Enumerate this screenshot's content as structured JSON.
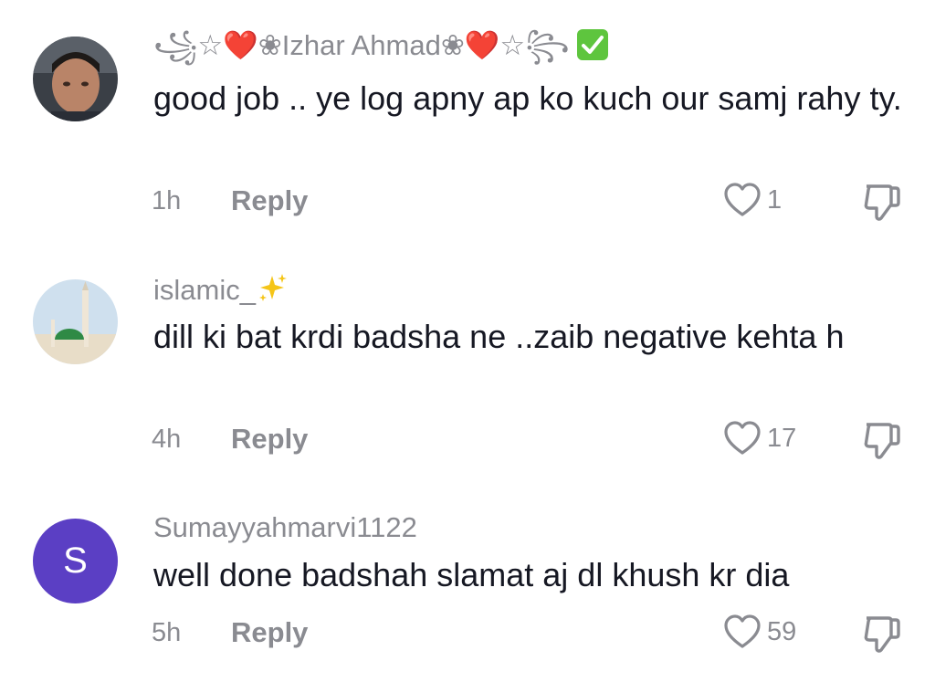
{
  "comments": [
    {
      "username": "꧁☆❤️❀Izhar Ahmad❀❤️☆꧂",
      "verified": true,
      "avatar": "profile-photo",
      "text": "good job .. ye log apny ap ko kuch our samj rahy ty.",
      "time": "1h",
      "reply_label": "Reply",
      "likes": "1"
    },
    {
      "username": "islamic_",
      "username_emoji": "sparkles",
      "avatar": "mosque-photo",
      "text": "dill ki bat krdi badsha ne ..zaib negative kehta h",
      "time": "4h",
      "reply_label": "Reply",
      "likes": "17"
    },
    {
      "username": "Sumayyahmarvi1122",
      "avatar": "letter-avatar",
      "avatar_letter": "S",
      "avatar_color": "#5b3fc4",
      "text": "well done badshah slamat aj dl khush kr dia",
      "time": "5h",
      "reply_label": "Reply",
      "likes": "59"
    }
  ],
  "colors": {
    "text": "#161823",
    "secondary": "#8a8b91",
    "verified": "#5ec53e"
  },
  "icons": {
    "like": "heart-outline-icon",
    "dislike": "thumbs-down-icon"
  }
}
